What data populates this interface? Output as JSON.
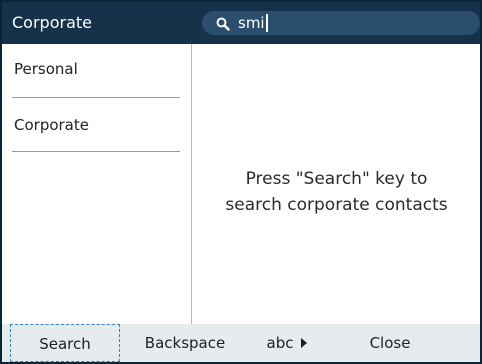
{
  "header": {
    "title": "Corporate",
    "search": {
      "icon": "search-icon",
      "value": "smi"
    }
  },
  "sidebar": {
    "items": [
      {
        "label": "Personal"
      },
      {
        "label": "Corporate"
      }
    ]
  },
  "content": {
    "message_line1": "Press \"Search\" key to",
    "message_line2": "search corporate contacts"
  },
  "softkeys": {
    "search": "Search",
    "backspace": "Backspace",
    "abc": "abc",
    "close": "Close"
  },
  "colors": {
    "header_bg": "#16324b",
    "search_bg": "#2b4d6e",
    "softkey_bg": "#e6ebee",
    "focus_outline": "#3a7ec2"
  }
}
